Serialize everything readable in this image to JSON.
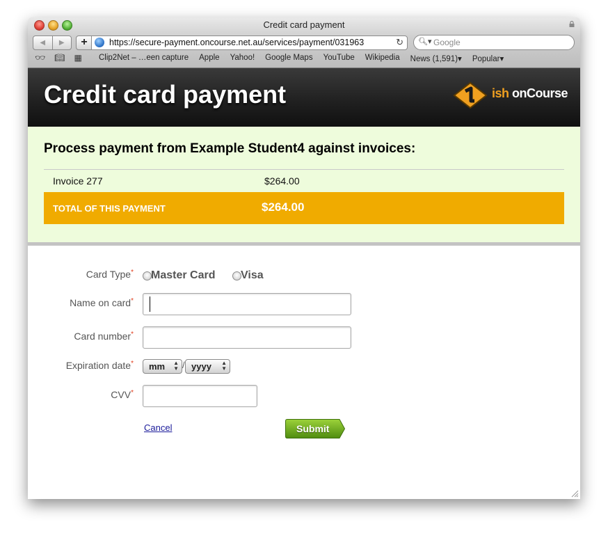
{
  "window": {
    "title": "Credit card payment"
  },
  "browser": {
    "url": "https://secure-payment.oncourse.net.au/services/payment/031963",
    "search_placeholder": "Google",
    "bookmarks": [
      "Clip2Net – …een capture",
      "Apple",
      "Yahoo!",
      "Google Maps",
      "YouTube",
      "Wikipedia",
      "News (1,591)▾",
      "Popular▾"
    ]
  },
  "header": {
    "title": "Credit card payment",
    "logo_ish": "ish",
    "logo_oncourse": "onCourse"
  },
  "invoice": {
    "heading": "Process payment from Example Student4 against invoices:",
    "rows": [
      {
        "label": "Invoice 277",
        "amount": "$264.00"
      }
    ],
    "total_label": "TOTAL OF THIS PAYMENT",
    "total_amount": "$264.00"
  },
  "form": {
    "card_type_label": "Card Type",
    "card_types": [
      "Master Card",
      "Visa"
    ],
    "name_label": "Name on card",
    "name_value": "",
    "number_label": "Card number",
    "number_value": "",
    "expiry_label": "Expiration date",
    "expiry_month": "mm",
    "expiry_year": "yyyy",
    "expiry_separator": "/",
    "cvv_label": "CVV",
    "cvv_value": "",
    "required_marker": "*",
    "cancel_label": "Cancel",
    "submit_label": "Submit"
  },
  "colors": {
    "accent_orange": "#f0ab00",
    "panel_green": "#eefcdc",
    "submit_green": "#6aa81c",
    "required_red": "#e23c1c"
  }
}
